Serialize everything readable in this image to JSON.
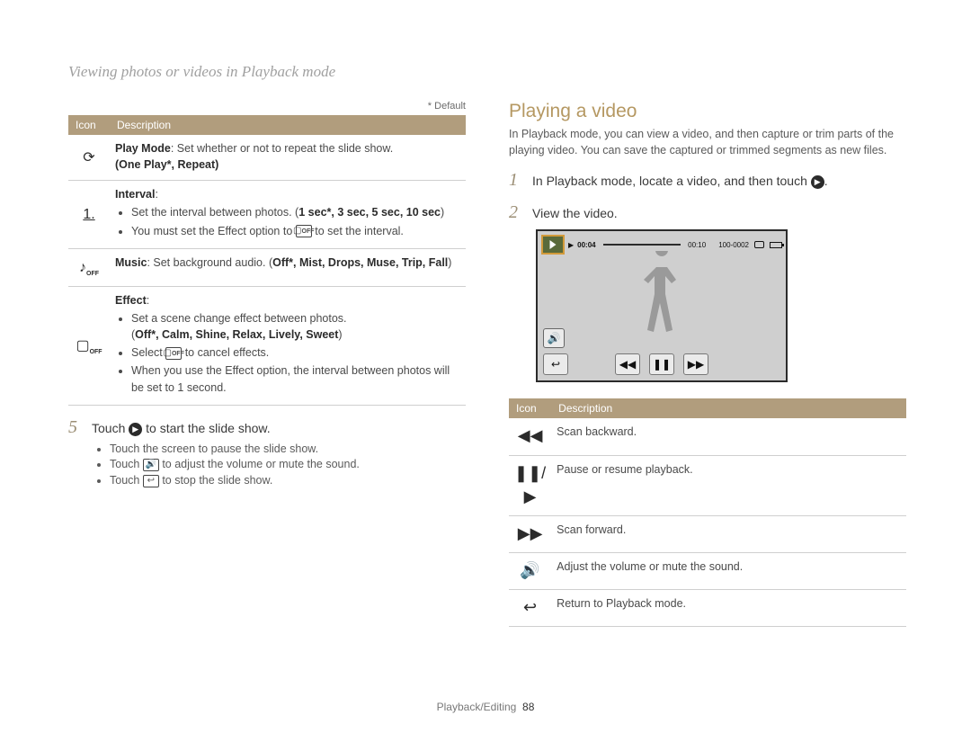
{
  "breadcrumb": "Viewing photos or videos in Playback mode",
  "default_note": "* Default",
  "left_table": {
    "headers": {
      "icon": "Icon",
      "desc": "Description"
    },
    "rows": {
      "playmode": {
        "icon_name": "repeat-icon",
        "label": "Play Mode",
        "text": ": Set whether or not to repeat the slide show.",
        "options": "(One Play*, Repeat)"
      },
      "interval": {
        "icon_name": "interval-icon",
        "label": "Interval",
        "b1": "Set the interval between photos. (",
        "b1_bold": "1 sec*, 3 sec, 5 sec, 10 sec",
        "b1_close": ")",
        "b2_a": "You must set the Effect option to ",
        "b2_b": " to set the interval."
      },
      "music": {
        "icon_name": "music-icon",
        "label": "Music",
        "text": ": Set background audio. (",
        "bold": "Off*, Mist, Drops, Muse, Trip, Fall",
        "close": ")"
      },
      "effect": {
        "icon_name": "effect-icon",
        "label": "Effect",
        "b1": "Set a scene change effect between photos.",
        "b1_opts_open": "(",
        "b1_opts": "Off*, Calm, Shine, Relax, Lively, Sweet",
        "b1_opts_close": ")",
        "b2_a": "Select ",
        "b2_b": " to cancel effects.",
        "b3": "When you use the Effect option, the interval between photos will be set to 1 second."
      }
    }
  },
  "step5": {
    "num": "5",
    "text_a": "Touch ",
    "text_b": " to start the slide show.",
    "subs": {
      "s1": "Touch the screen to pause the slide show.",
      "s2_a": "Touch ",
      "s2_b": " to adjust the volume or mute the sound.",
      "s3_a": "Touch ",
      "s3_b": " to stop the slide show."
    }
  },
  "right": {
    "heading": "Playing a video",
    "intro": "In Playback mode, you can view a video, and then capture or trim parts of the playing video. You can save the captured or trimmed segments as new files.",
    "step1": {
      "num": "1",
      "a": "In Playback mode, locate a video, and then touch ",
      "b": "."
    },
    "step2": {
      "num": "2",
      "text": "View the video."
    },
    "player": {
      "elapsed": "00:04",
      "total": "00:10",
      "file_index": "100-0002"
    },
    "table": {
      "headers": {
        "icon": "Icon",
        "desc": "Description"
      },
      "rows": {
        "rw": {
          "icon_name": "rewind-icon",
          "text": "Scan backward."
        },
        "pp": {
          "icon_name": "pause-play-icon",
          "text": "Pause or resume playback."
        },
        "ff": {
          "icon_name": "fast-forward-icon",
          "text": "Scan forward."
        },
        "vol": {
          "icon_name": "volume-icon",
          "text": "Adjust the volume or mute the sound."
        },
        "back": {
          "icon_name": "return-icon",
          "text": "Return to Playback mode."
        }
      }
    }
  },
  "footer": {
    "section": "Playback/Editing",
    "page": "88"
  },
  "glyphs": {
    "off_label": "OFF",
    "play": "▶",
    "rewind": "◀◀",
    "pause": "❚❚",
    "forward": "▶▶",
    "speaker": "🔊",
    "return": "↩",
    "pauseplay": "❚❚/▶",
    "note": "♪",
    "repeat": "⟳",
    "interval": "⎚",
    "effect_box": "▢"
  }
}
